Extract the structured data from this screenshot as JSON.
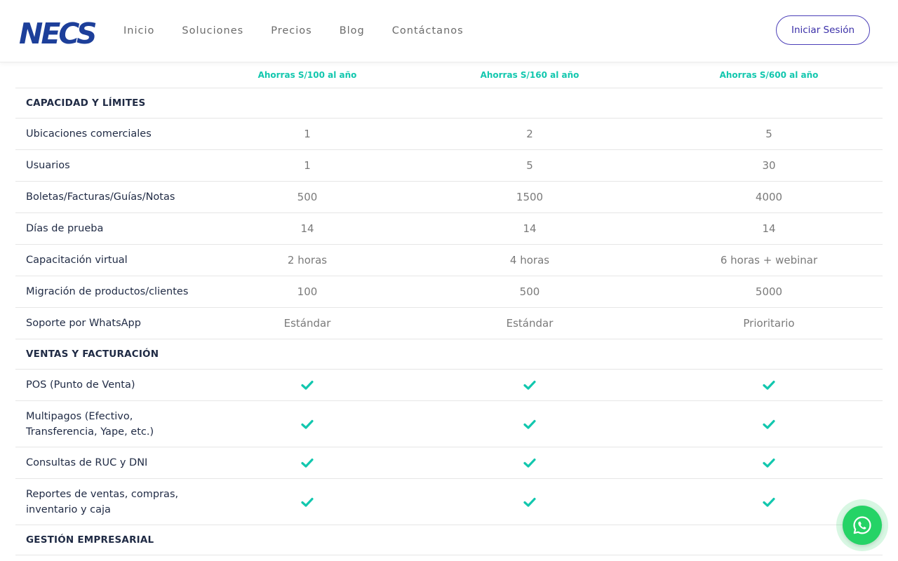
{
  "brand": {
    "logo_text": "NECS",
    "primary": "#1d3f9a",
    "accent": "#12c7ae",
    "login_color": "#4c3fb8",
    "whatsapp": "#25d366"
  },
  "nav": {
    "items": [
      {
        "label": "Inicio"
      },
      {
        "label": "Soluciones"
      },
      {
        "label": "Precios"
      },
      {
        "label": "Blog"
      },
      {
        "label": "Contáctanos"
      }
    ],
    "login_label": "Iniciar Sesión"
  },
  "savings": [
    "Ahorras S/100 al año",
    "Ahorras S/160 al año",
    "Ahorras S/600 al año"
  ],
  "sections": [
    {
      "title": "CAPACIDAD Y LÍMITES",
      "rows": [
        {
          "feature": "Ubicaciones comerciales",
          "values": [
            "1",
            "2",
            "5"
          ]
        },
        {
          "feature": "Usuarios",
          "values": [
            "1",
            "5",
            "30"
          ]
        },
        {
          "feature": "Boletas/Facturas/Guías/Notas",
          "values": [
            "500",
            "1500",
            "4000"
          ]
        },
        {
          "feature": "Días de prueba",
          "values": [
            "14",
            "14",
            "14"
          ]
        },
        {
          "feature": "Capacitación virtual",
          "values": [
            "2 horas",
            "4 horas",
            "6 horas + webinar"
          ]
        },
        {
          "feature": "Migración de productos/clientes",
          "values": [
            "100",
            "500",
            "5000"
          ]
        },
        {
          "feature": "Soporte por WhatsApp",
          "values": [
            "Estándar",
            "Estándar",
            "Prioritario"
          ]
        }
      ]
    },
    {
      "title": "VENTAS Y FACTURACIÓN",
      "rows": [
        {
          "feature": "POS (Punto de Venta)",
          "values": [
            "check-icon",
            "check-icon",
            "check-icon"
          ]
        },
        {
          "feature_lines": [
            "Multipagos (Efectivo,",
            "Transferencia, Yape, etc.)"
          ],
          "values": [
            "check-icon",
            "check-icon",
            "check-icon"
          ]
        },
        {
          "feature": "Consultas de RUC y DNI",
          "values": [
            "check-icon",
            "check-icon",
            "check-icon"
          ]
        },
        {
          "feature_lines": [
            "Reportes de ventas, compras,",
            "inventario y caja"
          ],
          "values": [
            "check-icon",
            "check-icon",
            "check-icon"
          ]
        }
      ]
    },
    {
      "title": "GESTIÓN EMPRESARIAL",
      "rows": []
    }
  ],
  "whatsapp_button": {
    "icon": "whatsapp-icon"
  }
}
